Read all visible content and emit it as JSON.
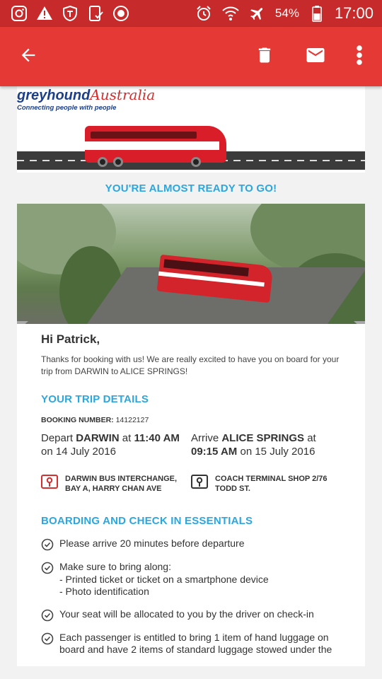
{
  "status_bar": {
    "battery_percent": "54%",
    "time": "17:00",
    "left_icons": [
      "instagram-icon",
      "warning-icon",
      "shield-icon",
      "tablet-check-icon",
      "lion-icon"
    ],
    "right_icons": [
      "alarm-icon",
      "wifi-icon",
      "airplane-icon",
      "battery-icon"
    ]
  },
  "app_bar": {
    "back_icon": "arrow-left-icon",
    "actions": [
      "delete-icon",
      "mail-icon",
      "more-vert-icon"
    ]
  },
  "email": {
    "logo": {
      "brand": "greyhound",
      "brand_suffix": "Australia",
      "tagline": "Connecting people with people"
    },
    "banner": "YOU'RE ALMOST READY TO GO!",
    "greeting": "Hi Patrick,",
    "intro": "Thanks for booking with us! We are really excited to have you on board for your trip from DARWIN to ALICE SPRINGS!",
    "trip_title": "YOUR TRIP DETAILS",
    "booking_label": "BOOKING NUMBER:",
    "booking_number": "14122127",
    "depart": {
      "label": "Depart",
      "city": "DARWIN",
      "at": "at",
      "time": "11:40 AM",
      "on": "on",
      "date": "14 July 2016"
    },
    "arrive": {
      "label": "Arrive",
      "city": "ALICE SPRINGS",
      "at": "at",
      "time": "09:15 AM",
      "on": "on",
      "date": "15 July 2016"
    },
    "depart_location": "DARWIN BUS INTERCHANGE, BAY A, HARRY CHAN AVE",
    "arrive_location": "COACH TERMINAL SHOP 2/76 TODD ST.",
    "boarding_title": "BOARDING AND CHECK IN ESSENTIALS",
    "essentials": [
      "Please arrive 20 minutes before departure",
      "Make sure to bring along:",
      "- Printed ticket or ticket on a smartphone device",
      "- Photo identification",
      "Your seat will be allocated to you by the driver on check-in",
      "Each passenger is entitled to bring 1 item of hand luggage on board and have 2 items of standard luggage stowed under the"
    ]
  },
  "colors": {
    "status_bar": "#c62a2a",
    "app_bar": "#e53935",
    "accent_blue": "#2aa7e0",
    "brand_navy": "#1b3f8b"
  }
}
